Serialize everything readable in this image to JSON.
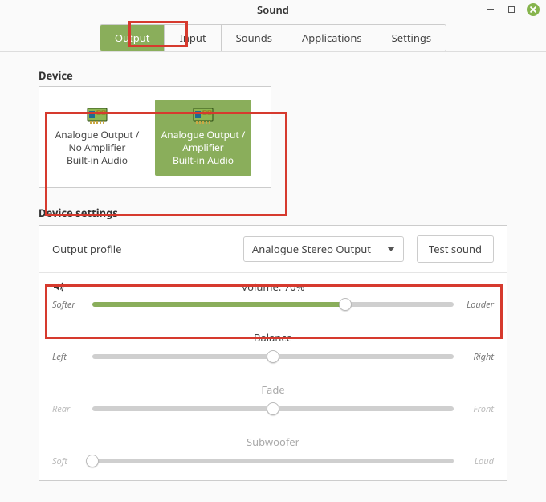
{
  "window": {
    "title": "Sound"
  },
  "tabs": {
    "output": "Output",
    "input": "Input",
    "sounds": "Sounds",
    "applications": "Applications",
    "settings": "Settings",
    "active": "output"
  },
  "device_section": {
    "label": "Device",
    "items": [
      {
        "line1": "Analogue Output /",
        "line2": "No Amplifier",
        "line3": "Built-in Audio",
        "selected": false
      },
      {
        "line1": "Analogue Output /",
        "line2": "Amplifier",
        "line3": "Built-in Audio",
        "selected": true
      }
    ]
  },
  "device_settings": {
    "label": "Device settings",
    "profile_label": "Output profile",
    "profile_value": "Analogue Stereo Output",
    "test_button": "Test sound"
  },
  "sliders": {
    "volume": {
      "title": "Volume: 70%",
      "left_label": "Softer",
      "right_label": "Louder",
      "percent": 70
    },
    "balance": {
      "title": "Balance",
      "left_label": "Left",
      "right_label": "Right",
      "percent": 50
    },
    "fade": {
      "title": "Fade",
      "left_label": "Rear",
      "right_label": "Front",
      "percent": 50,
      "enabled": false
    },
    "subwoofer": {
      "title": "Subwoofer",
      "left_label": "Soft",
      "right_label": "Loud",
      "percent": 0,
      "enabled": false
    }
  }
}
